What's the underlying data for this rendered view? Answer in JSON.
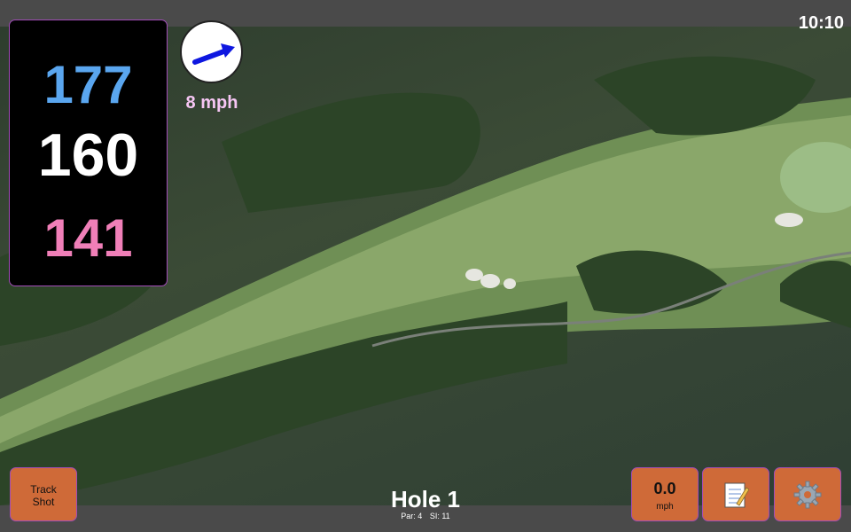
{
  "clock": "10:10",
  "distances": {
    "back": "177",
    "middle": "160",
    "front": "141"
  },
  "wind": {
    "speed": "8 mph",
    "icon": "wind-direction-arrow-icon"
  },
  "hole": {
    "title": "Hole 1",
    "par": "Par: 4",
    "si": "SI: 11"
  },
  "buttons": {
    "track_shot": "Track\nShot",
    "speed_value": "0.0",
    "speed_unit": "mph",
    "notes_icon": "notepad-icon",
    "settings_icon": "gear-icon"
  },
  "colors": {
    "back": "#5aa6ef",
    "front": "#f07fb8",
    "button": "#cf6a38",
    "border": "#a24cb8"
  }
}
